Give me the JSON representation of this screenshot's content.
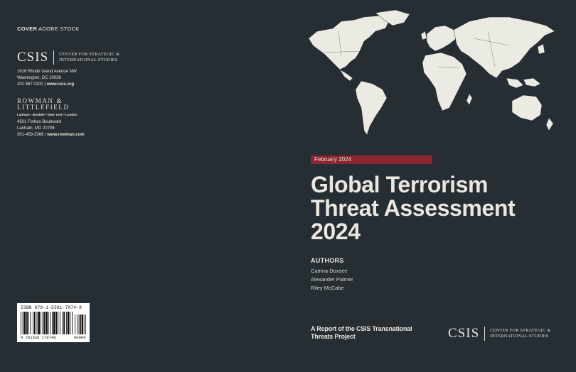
{
  "back_cover": {
    "cover_label": "COVER",
    "cover_credit": "ADOBE STOCK",
    "csis_logo_text": "CSIS",
    "csis_full_line1": "CENTER FOR STRATEGIC &",
    "csis_full_line2": "INTERNATIONAL STUDIES",
    "csis_address_line1": "1616 Rhode Island Avenue NW",
    "csis_address_line2": "Washington, DC 20036",
    "csis_phone": "202 887 0200",
    "csis_web": "www.csis.org",
    "publisher_line1": "ROWMAN &",
    "publisher_line2": "LITTLEFIELD",
    "publisher_cities": "Lanham • Boulder • New York • London",
    "publisher_address_line1": "4501 Forbes Boulevard",
    "publisher_address_line2": "Lanham, MD 20706",
    "publisher_phone": "301-459-3366",
    "publisher_web": "www.rowman.com",
    "isbn": "ISBN 978-1-5381-7074-8",
    "barcode_number": "9 781538 170748",
    "barcode_addon": "90000"
  },
  "front_cover": {
    "date": "February 2024",
    "title_line1": "Global Terrorism",
    "title_line2": "Threat Assessment",
    "title_line3": "2024",
    "authors_heading": "AUTHORS",
    "authors": [
      "Catrina Doxsee",
      "Alexander Palmer",
      "Riley McCabe"
    ],
    "report_line1": "A Report of the CSIS Transnational",
    "report_line2": "Threats Project",
    "csis_logo_text": "CSIS",
    "csis_full_line1": "CENTER FOR STRATEGIC &",
    "csis_full_line2": "INTERNATIONAL STUDIES"
  },
  "colors": {
    "background": "#262d33",
    "text": "#e9e7df",
    "date_band": "#8b2532",
    "map_fill": "#ecebe3"
  },
  "icons": [
    "world-map-image",
    "barcode-image"
  ]
}
